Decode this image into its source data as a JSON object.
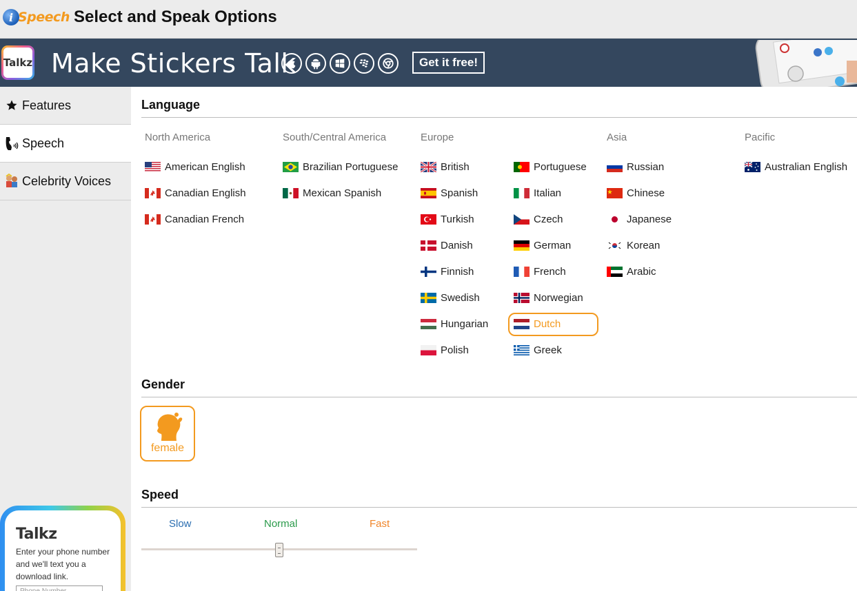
{
  "header": {
    "brand": "Speech",
    "brand_letter": "i",
    "title": "Select and Speak Options"
  },
  "banner": {
    "app_icon_label": "Talkz",
    "title": "Make Stickers Talk",
    "platforms": [
      "apple-icon",
      "android-icon",
      "windows-icon",
      "blackberry-icon",
      "chrome-icon"
    ],
    "cta": "Get it free!"
  },
  "sidebar": {
    "items": [
      {
        "label": "Features",
        "icon": "star-icon",
        "active": false
      },
      {
        "label": "Speech",
        "icon": "speech-icon",
        "active": true
      },
      {
        "label": "Celebrity Voices",
        "icon": "celebrity-icon",
        "active": false
      }
    ],
    "promo": {
      "title": "Talkz",
      "text": "Enter your phone number and we'll text you a download link.",
      "placeholder": "Phone Number"
    }
  },
  "language": {
    "heading": "Language",
    "regions": [
      "North America",
      "South/Central America",
      "Europe",
      "Asia",
      "Pacific"
    ],
    "north_america": [
      "American English",
      "Canadian English",
      "Canadian French"
    ],
    "south_central_america": [
      "Brazilian Portuguese",
      "Mexican Spanish"
    ],
    "europe_col1": [
      "British",
      "Spanish",
      "Turkish",
      "Danish",
      "Finnish",
      "Swedish",
      "Hungarian",
      "Polish"
    ],
    "europe_col2": [
      "Portuguese",
      "Italian",
      "Czech",
      "German",
      "French",
      "Norwegian",
      "Dutch",
      "Greek"
    ],
    "asia": [
      "Russian",
      "Chinese",
      "Japanese",
      "Korean",
      "Arabic"
    ],
    "pacific": [
      "Australian English"
    ],
    "selected": "Dutch"
  },
  "gender": {
    "heading": "Gender",
    "option": "female"
  },
  "speed": {
    "heading": "Speed",
    "labels": [
      "Slow",
      "Normal",
      "Fast"
    ],
    "label_colors": [
      "#2a6db0",
      "#2a9a4a",
      "#f0852a"
    ],
    "value": 0.5
  },
  "colors": {
    "accent": "#f39a1f",
    "banner": "#34475e"
  }
}
